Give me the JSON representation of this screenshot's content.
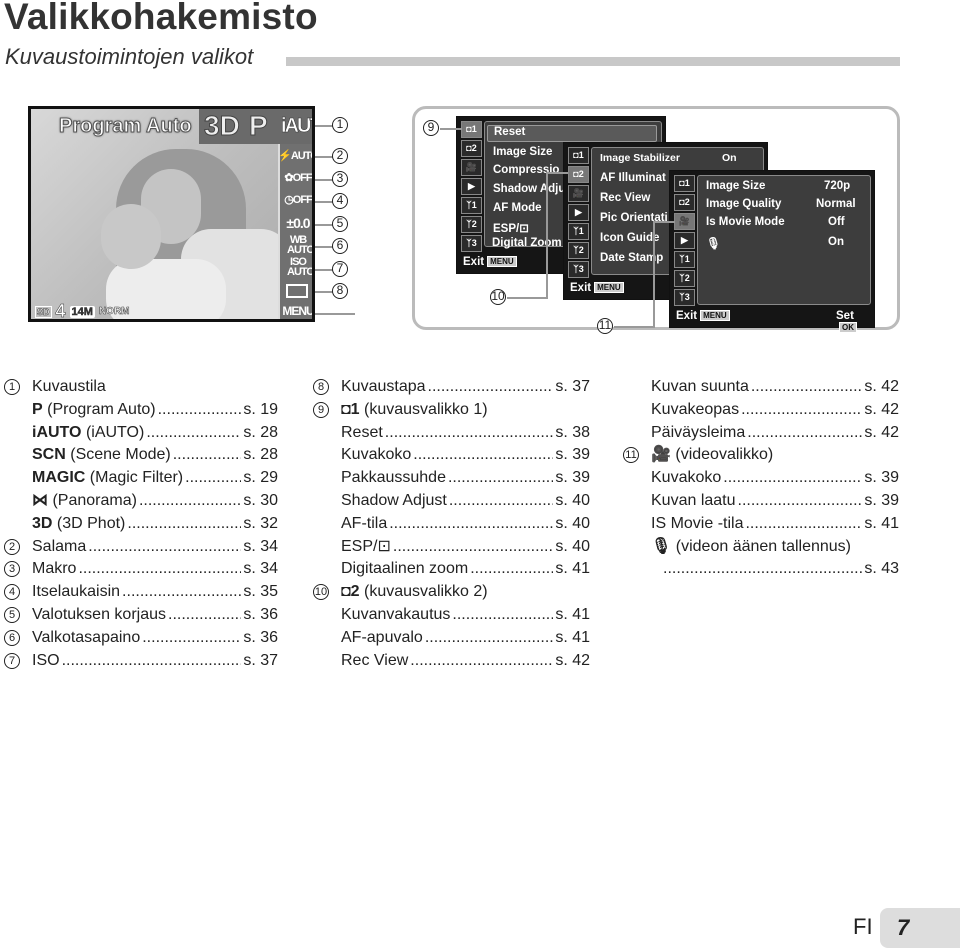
{
  "header": {
    "title": "Valikkohakemisto",
    "subtitle": "Kuvaustoimintojen valikot"
  },
  "camera_screen": {
    "mode_label": "Program Auto",
    "top_modes": [
      "3D",
      "P",
      "iAUTO"
    ],
    "side_indicators": [
      "⚡AUTO",
      "✿OFF",
      "◷OFF",
      "±0.0",
      "WB AUTO",
      "ISO AUTO",
      "▭",
      "MENU"
    ],
    "bottom": {
      "card": "SD",
      "shots": "4",
      "size": "14M",
      "quality": "NORM"
    },
    "callouts": [
      "1",
      "2",
      "3",
      "4",
      "5",
      "6",
      "7",
      "8"
    ]
  },
  "menus": {
    "callouts": {
      "shooting1": "9",
      "shooting2": "10",
      "movie": "11"
    },
    "tab_icons": [
      "camera-1",
      "camera-2",
      "movie",
      "playback",
      "setup-1",
      "setup-2",
      "setup-3"
    ],
    "tab_glyphs": [
      "◘1",
      "◘2",
      "🎥",
      "▶",
      "ᛉ1",
      "ᛉ2",
      "ᛉ3"
    ],
    "shooting_menu_1": {
      "items": [
        "Reset",
        "Image Size",
        "Compressio",
        "Shadow Adju",
        "AF Mode",
        "ESP/⊡",
        "Digital Zoom"
      ],
      "exit": "Exit",
      "exit_key": "MENU"
    },
    "shooting_menu_2": {
      "items": [
        {
          "label": "Image Stabilizer",
          "value": "On"
        },
        {
          "label": "AF Illuminat",
          "value": ""
        },
        {
          "label": "Rec View",
          "value": ""
        },
        {
          "label": "Pic Orientati",
          "value": ""
        },
        {
          "label": "Icon Guide",
          "value": ""
        },
        {
          "label": "Date Stamp",
          "value": ""
        }
      ],
      "exit": "Exit",
      "exit_key": "MENU"
    },
    "movie_menu": {
      "items": [
        {
          "label": "Image Size",
          "value": "720p"
        },
        {
          "label": "Image Quality",
          "value": "Normal"
        },
        {
          "label": "Is Movie Mode",
          "value": "Off"
        },
        {
          "label": "🎙",
          "value": "On"
        }
      ],
      "exit": "Exit",
      "exit_key": "MENU",
      "set": "Set",
      "set_key": "OK"
    }
  },
  "index": {
    "column1": [
      {
        "num": "1",
        "label": "Kuvaustila",
        "page": ""
      },
      {
        "num": "",
        "symbol": "P",
        "label": "(Program Auto)",
        "page": "s. 19"
      },
      {
        "num": "",
        "symbol": "iAUTO",
        "label": "(iAUTO)",
        "page": "s. 28"
      },
      {
        "num": "",
        "symbol": "SCN",
        "label": "(Scene Mode)",
        "page": "s. 28"
      },
      {
        "num": "",
        "symbol": "MAGIC",
        "label": "(Magic Filter)",
        "page": "s. 29"
      },
      {
        "num": "",
        "symbol": "⋈",
        "label": "(Panorama)",
        "page": "s. 30"
      },
      {
        "num": "",
        "symbol": "3D",
        "label": "(3D Phot)",
        "page": "s. 32"
      },
      {
        "num": "2",
        "label": "Salama",
        "page": "s. 34"
      },
      {
        "num": "3",
        "label": "Makro",
        "page": "s. 34"
      },
      {
        "num": "4",
        "label": "Itselaukaisin",
        "page": "s. 35"
      },
      {
        "num": "5",
        "label": "Valotuksen korjaus",
        "page": "s. 36"
      },
      {
        "num": "6",
        "label": "Valkotasapaino",
        "page": "s. 36"
      },
      {
        "num": "7",
        "label": "ISO",
        "page": "s. 37"
      }
    ],
    "column2": [
      {
        "num": "8",
        "label": "Kuvaustapa",
        "page": "s. 37"
      },
      {
        "num": "9",
        "symbol": "◘1",
        "label": "(kuvausvalikko 1)",
        "page": ""
      },
      {
        "num": "",
        "label": "Reset",
        "page": "s. 38"
      },
      {
        "num": "",
        "label": "Kuvakoko",
        "page": "s. 39"
      },
      {
        "num": "",
        "label": "Pakkaussuhde",
        "page": "s. 39"
      },
      {
        "num": "",
        "label": "Shadow Adjust",
        "page": "s. 40"
      },
      {
        "num": "",
        "label": "AF-tila",
        "page": "s. 40"
      },
      {
        "num": "",
        "label": "ESP/⊡",
        "page": "s. 40"
      },
      {
        "num": "",
        "label": "Digitaalinen zoom",
        "page": "s. 41"
      },
      {
        "num": "10",
        "symbol": "◘2",
        "label": "(kuvausvalikko 2)",
        "page": ""
      },
      {
        "num": "",
        "label": "Kuvanvakautus",
        "page": "s. 41"
      },
      {
        "num": "",
        "label": "AF-apuvalo",
        "page": "s. 41"
      },
      {
        "num": "",
        "label": "Rec View",
        "page": "s. 42"
      }
    ],
    "column3": [
      {
        "num": "",
        "label": "Kuvan suunta",
        "page": "s. 42"
      },
      {
        "num": "",
        "label": "Kuvakeopas",
        "page": "s. 42"
      },
      {
        "num": "",
        "label": "Päiväysleima",
        "page": "s. 42"
      },
      {
        "num": "11",
        "symbol": "🎥",
        "label": "(videovalikko)",
        "page": ""
      },
      {
        "num": "",
        "label": "Kuvakoko",
        "page": "s. 39"
      },
      {
        "num": "",
        "label": "Kuvan laatu",
        "page": "s. 39"
      },
      {
        "num": "",
        "label": "IS Movie -tila",
        "page": "s. 41"
      },
      {
        "num": "",
        "symbol": "🎙",
        "label": "(videon äänen tallennus)",
        "page": ""
      },
      {
        "num": "",
        "label": "",
        "page": "s. 43"
      }
    ]
  },
  "footer": {
    "lang": "FI",
    "page": "7"
  }
}
